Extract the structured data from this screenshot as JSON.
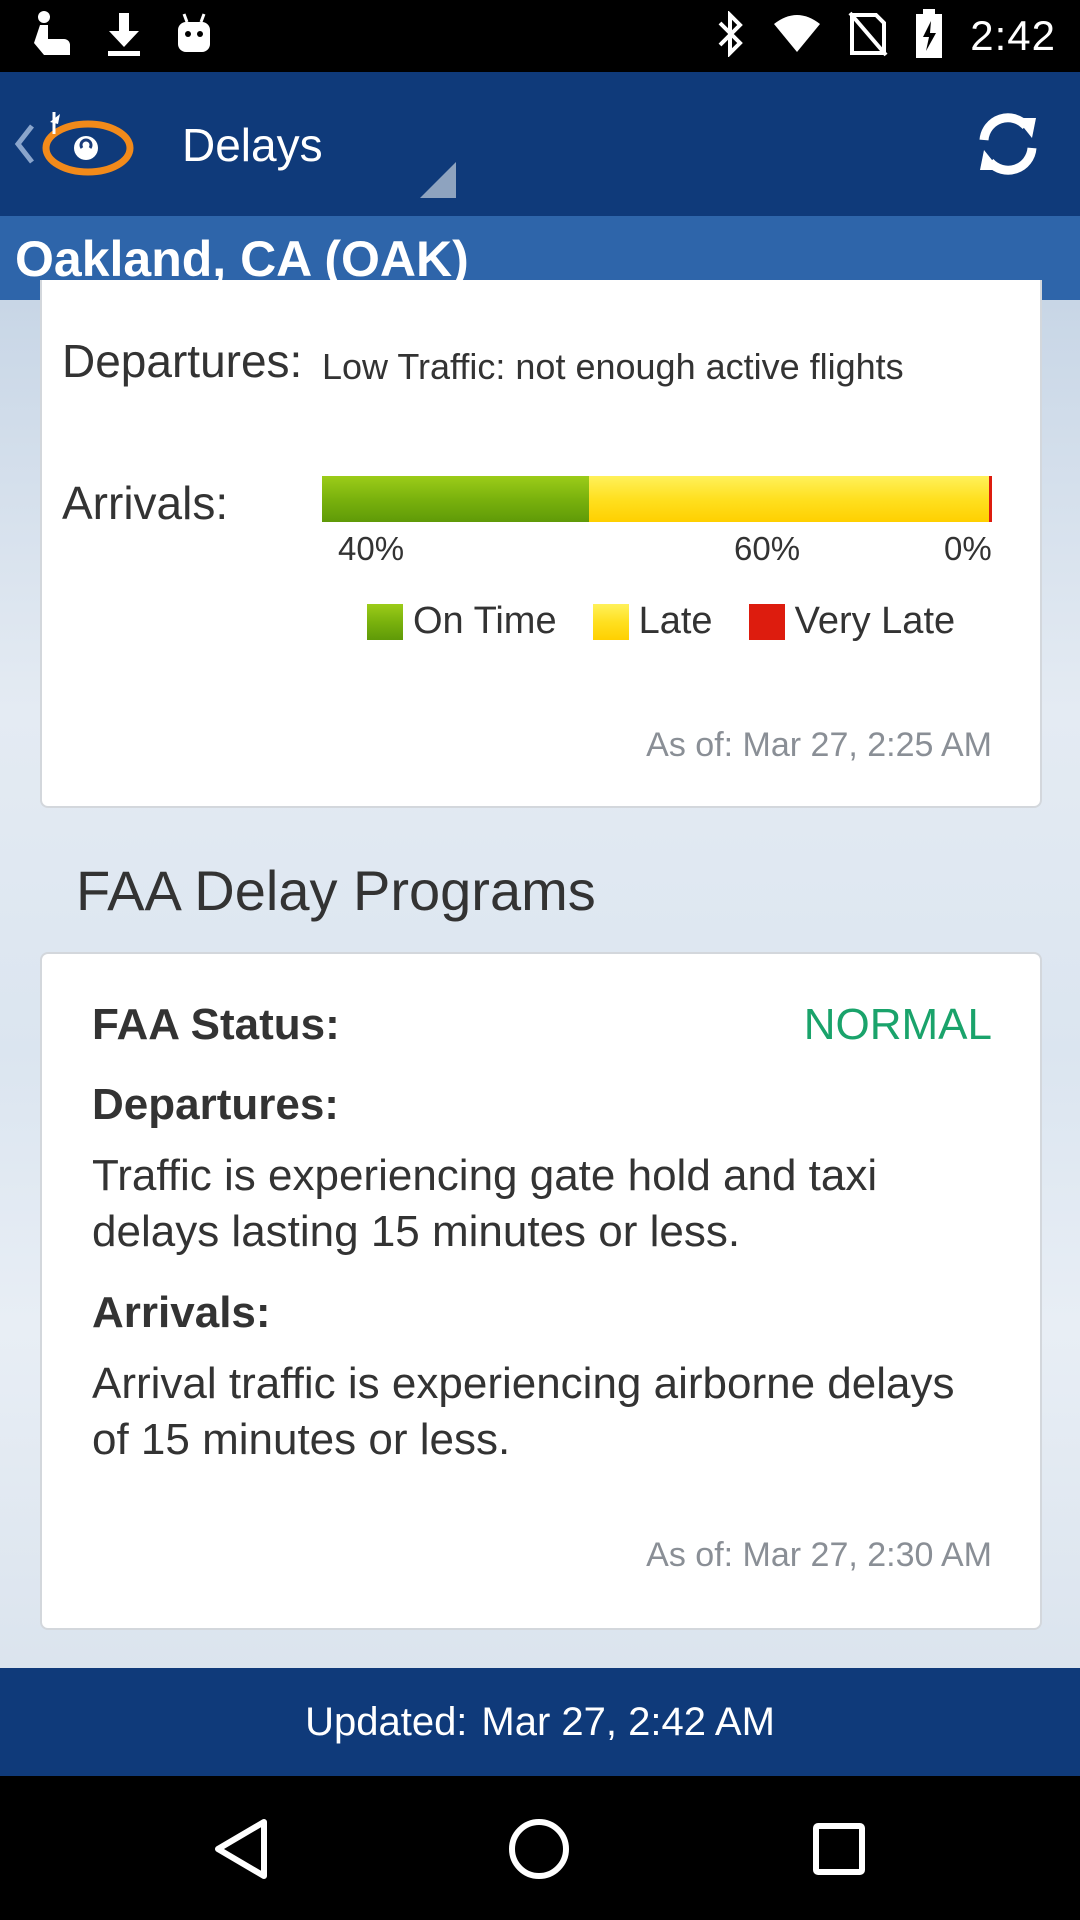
{
  "status_bar": {
    "time": "2:42",
    "left_icons": [
      "touch-icon",
      "download-icon",
      "android-icon"
    ],
    "right_icons": [
      "bluetooth-icon",
      "wifi-icon",
      "no-sim-icon",
      "battery-charging-icon"
    ]
  },
  "app_bar": {
    "title": "Delays",
    "back_icon": "chevron-left-icon",
    "logo_icon": "flightview-logo-icon",
    "refresh_icon": "refresh-icon"
  },
  "location": {
    "title": "Oakland, CA (OAK)"
  },
  "airport_status": {
    "departures_label": "Departures:",
    "departures_text": "Low Traffic: not enough active flights",
    "arrivals_label": "Arrivals:",
    "arrivals_breakdown": {
      "on_time_pct": "40%",
      "late_pct": "60%",
      "very_late_pct": "0%",
      "on_time_fraction": 0.4,
      "late_fraction": 0.6,
      "very_late_fraction": 0.0
    },
    "legend": [
      {
        "label": "On Time",
        "color": "#7ab20d"
      },
      {
        "label": "Late",
        "color": "#ffe020"
      },
      {
        "label": "Very Late",
        "color": "#dd1c0e"
      }
    ],
    "as_of": "As of: Mar 27, 2:25 AM"
  },
  "faa_section": {
    "title": "FAA Delay Programs",
    "status_label": "FAA Status:",
    "status_value": "NORMAL",
    "status_color": "#1aa36b",
    "departures_label": "Departures:",
    "departures_text": "Traffic is experiencing gate hold and taxi delays lasting 15 minutes or less.",
    "arrivals_label": "Arrivals:",
    "arrivals_text": "Arrival traffic is experiencing airborne delays of 15 minutes or less.",
    "as_of": "As of: Mar 27, 2:30 AM"
  },
  "footer": {
    "updated_label": "Updated:",
    "updated_value": "Mar 27, 2:42 AM"
  },
  "nav_bar": {
    "icons": [
      "back-triangle-icon",
      "home-circle-icon",
      "recents-square-icon"
    ]
  }
}
